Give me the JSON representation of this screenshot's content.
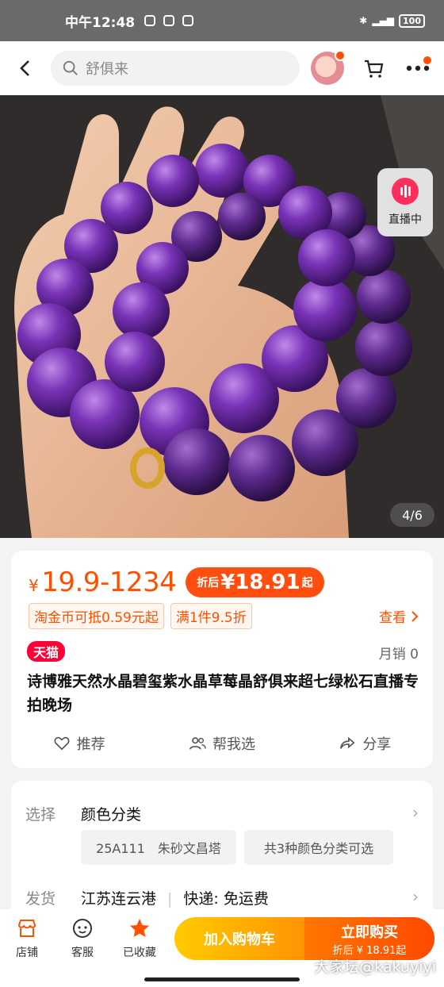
{
  "status": {
    "time": "中午12:48",
    "battery": "100"
  },
  "search": {
    "placeholder": "舒俱来"
  },
  "hero": {
    "live_label": "直播中",
    "page_indicator": "4/6"
  },
  "price": {
    "range": "19.9-1234",
    "currency": "¥",
    "coupon_prefix": "折后",
    "coupon_value": "¥18.91",
    "coupon_suffix": "起",
    "tags": [
      "淘金币可抵0.59元起",
      "满1件9.5折"
    ],
    "see_more": "查看"
  },
  "product": {
    "store_badge": "天猫",
    "monthly_sales": "月销 0",
    "title": "诗博雅天然水晶碧玺紫水晶草莓晶舒俱来超七绿松石直播专拍晚场"
  },
  "actions": [
    "推荐",
    "帮我选",
    "分享"
  ],
  "options": {
    "select_label": "选择",
    "select_value": "颜色分类",
    "chips": [
      "25A111　朱砂文昌塔",
      "共3种颜色分类可选"
    ],
    "ship_label": "发货",
    "ship_from": "江苏连云港",
    "ship_method": "快递: 免运费"
  },
  "bottom_bar": {
    "store": "店铺",
    "service": "客服",
    "favorited": "已收藏",
    "add_cart": "加入购物车",
    "buy_now": "立即购买",
    "buy_now_sub": "折后 ¥ 18.91起"
  },
  "watermark": "大家坛@kakuyiyi",
  "colors": {
    "accent": "#ff5000",
    "tmall": "#ff0036",
    "cart_gradient": [
      "#ffcb00",
      "#ff9402"
    ],
    "buy_gradient": [
      "#ff7700",
      "#ff4900"
    ]
  }
}
